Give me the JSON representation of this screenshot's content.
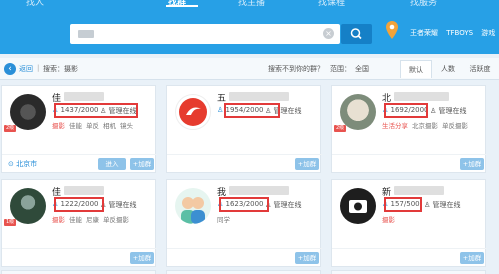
{
  "header": {
    "nav": [
      "找人",
      "找群",
      "找主播",
      "找课程",
      "找服务"
    ],
    "active_nav": "找群",
    "search": {
      "placeholder": ""
    },
    "tags": [
      "王者荣耀",
      "TFBOYS",
      "游戏"
    ]
  },
  "toolbar": {
    "back": "返回",
    "breadcrumb": "搜索：摄影",
    "not_found": "搜索不到你的群？",
    "range_label": "范围：",
    "city": "全国",
    "sort": [
      "默认",
      "人数",
      "活跃度"
    ]
  },
  "cards": [
    {
      "name": "佳",
      "members": "1437/2000",
      "manager": "管理在线",
      "tags": [
        "摄影",
        "佳能",
        "单反",
        "相机",
        "镜头"
      ],
      "city": "北京市",
      "level": "2级",
      "buttons": [
        "进入",
        "+加群"
      ],
      "colors": {
        "avatar": "#3c3c3c"
      }
    },
    {
      "name": "五",
      "members": "1954/2000",
      "manager": "管理在线",
      "tags": [],
      "city": "",
      "level": "",
      "buttons": [
        "+加群"
      ],
      "colors": {
        "avatar": "#e63b2e"
      }
    },
    {
      "name": "北",
      "members": "1692/2000",
      "manager": "管理在线",
      "tags": [
        "生活分享",
        "北京摄影",
        "单反摄影"
      ],
      "city": "",
      "level": "2级",
      "buttons": [
        "+加群"
      ],
      "colors": {
        "avatar": "#6b7a69"
      }
    },
    {
      "name": "佳",
      "members": "1222/2000",
      "manager": "管理在线",
      "tags": [
        "摄影",
        "佳能",
        "尼康",
        "单反摄影"
      ],
      "city": "",
      "level": "1级",
      "buttons": [
        "+加群"
      ],
      "colors": {
        "avatar": "#2f4a3a"
      }
    },
    {
      "name": "我",
      "members": "1623/2000",
      "manager": "管理在线",
      "tags": [
        "同学"
      ],
      "city": "",
      "level": "",
      "buttons": [
        "+加群"
      ],
      "colors": {
        "avatar": "#5bbfa5"
      }
    },
    {
      "name": "新",
      "members": "157/500",
      "manager": "管理在线",
      "tags": [
        "摄影"
      ],
      "city": "",
      "level": "",
      "buttons": [
        "+加群"
      ],
      "colors": {
        "avatar": "#1e1e1e"
      }
    }
  ],
  "theme": {
    "primary": "#27a0e6",
    "highlight": "#e23a3a",
    "link": "#2a8fd8"
  }
}
